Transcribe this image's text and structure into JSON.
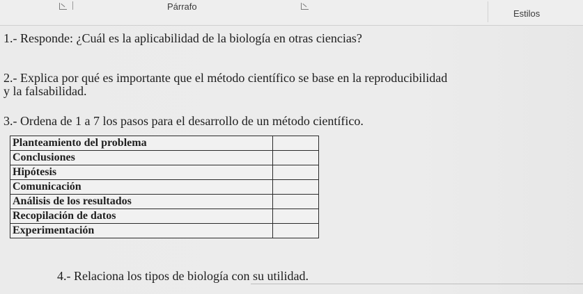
{
  "ribbon": {
    "paragraph_label": "Párrafo",
    "styles_label": "Estilos"
  },
  "questions": {
    "q1": "1.- Responde: ¿Cuál es la aplicabilidad de la biología en otras ciencias?",
    "q2_line1": "2.- Explica por qué es importante que el método científico se base en la reproducibilidad",
    "q2_line2": "y la falsabilidad.",
    "q3": "3.- Ordena de 1 a 7 los pasos para el desarrollo de un método científico.",
    "q4": "4.- Relaciona los tipos de biología con su utilidad."
  },
  "steps_table": {
    "rows": [
      {
        "label": "Planteamiento del problema",
        "number": ""
      },
      {
        "label": "Conclusiones",
        "number": ""
      },
      {
        "label": "Hipótesis",
        "number": ""
      },
      {
        "label": "Comunicación",
        "number": ""
      },
      {
        "label": "Análisis de los resultados",
        "number": ""
      },
      {
        "label": "Recopilación de datos",
        "number": ""
      },
      {
        "label": "Experimentación",
        "number": ""
      }
    ]
  },
  "icons": {
    "paragraph_launcher": "dialog-launcher-icon",
    "styles_launcher": "dialog-launcher-icon"
  }
}
